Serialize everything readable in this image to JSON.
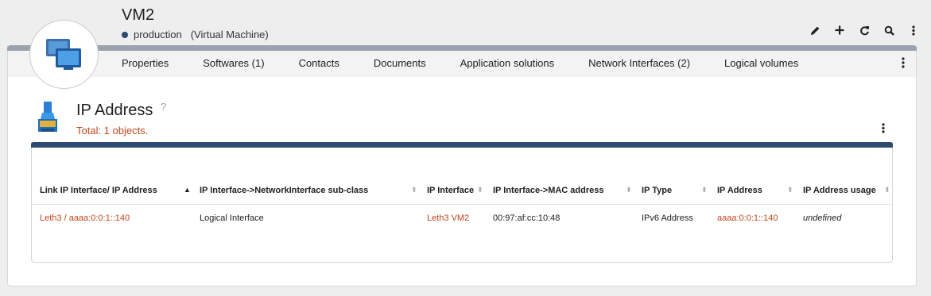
{
  "header": {
    "title": "VM2",
    "status": "production",
    "type": "(Virtual Machine)",
    "status_color": "#2e4a70"
  },
  "toolbar": {
    "icons": [
      "pencil-icon",
      "plus-icon",
      "refresh-icon",
      "search-icon",
      "more-icon"
    ]
  },
  "tabs": [
    {
      "label": "Properties"
    },
    {
      "label": "Softwares (1)"
    },
    {
      "label": "Contacts"
    },
    {
      "label": "Documents"
    },
    {
      "label": "Application solutions"
    },
    {
      "label": "Network Interfaces (2)"
    },
    {
      "label": "Logical volumes"
    }
  ],
  "section": {
    "title": "IP Address",
    "help": "?",
    "total": "Total: 1 objects."
  },
  "table": {
    "columns": [
      "Link IP Interface/ IP Address",
      "IP Interface->NetworkInterface sub-class",
      "IP Interface",
      "IP Interface->MAC address",
      "IP Type",
      "IP Address",
      "IP Address usage"
    ],
    "rows": [
      {
        "link": "Leth3 / aaaa:0:0:1::140",
        "subclass": "Logical Interface",
        "ip_interface": "Leth3 VM2",
        "mac": "00:97:af:cc:10:48",
        "ip_type": "IPv6 Address",
        "ip_address": "aaaa:0:0:1::140",
        "usage": "undefined"
      }
    ]
  },
  "colors": {
    "accent": "#c0461b",
    "brand_dark": "#2e4a70",
    "topbar": "#9aa3ad"
  }
}
